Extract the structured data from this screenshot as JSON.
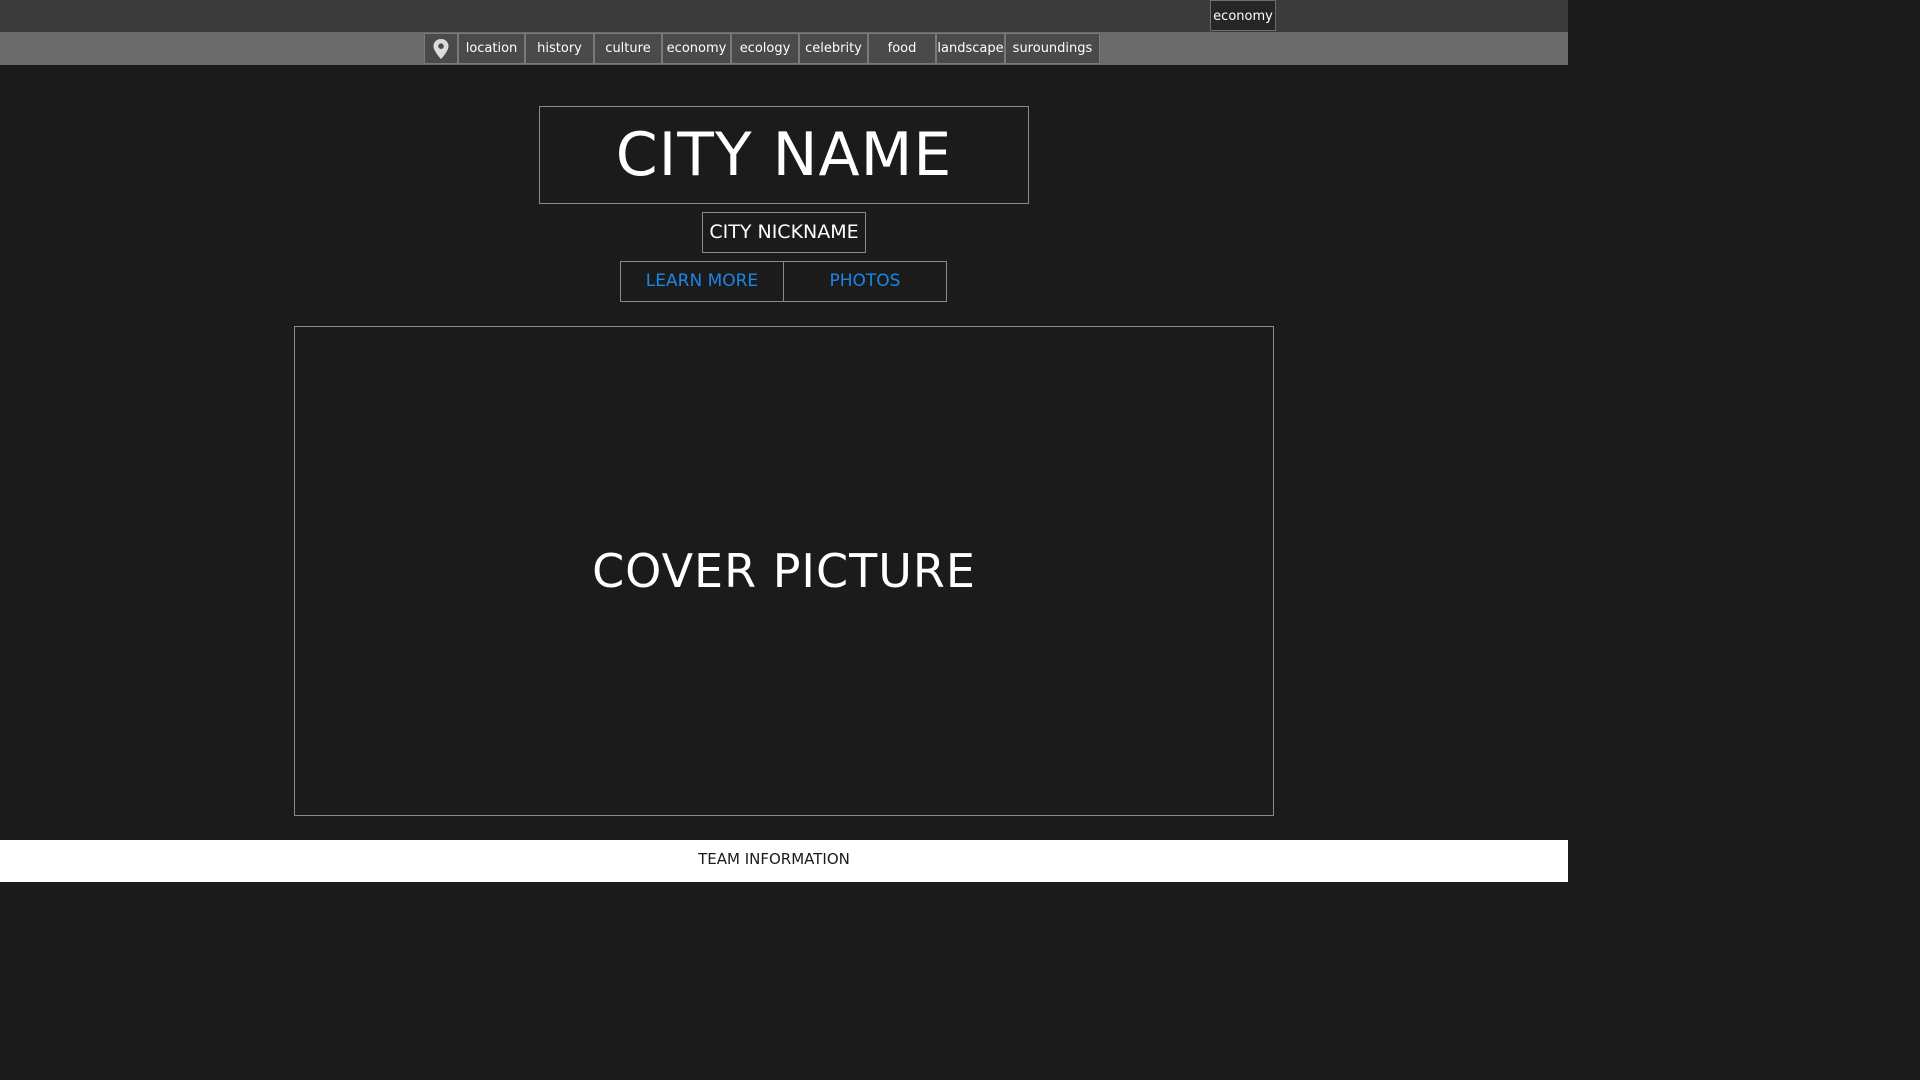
{
  "top_bar": {
    "badge": "economy"
  },
  "nav": {
    "pin_icon": "map-pin-icon",
    "items": [
      {
        "label": "location"
      },
      {
        "label": "history"
      },
      {
        "label": "culture"
      },
      {
        "label": "economy"
      },
      {
        "label": "ecology"
      },
      {
        "label": "celebrity"
      },
      {
        "label": "food"
      },
      {
        "label": "landscape"
      },
      {
        "label": "suroundings"
      }
    ]
  },
  "hero": {
    "city_name": "CITY NAME",
    "city_nickname": "CITY NICKNAME",
    "learn_more_label": "LEARN MORE",
    "photos_label": "PHOTOS"
  },
  "cover": {
    "label": "COVER PICTURE"
  },
  "footer": {
    "label": "TEAM INFORMATION"
  },
  "colors": {
    "background": "#1b1b1b",
    "top_bar": "#3b3b3b",
    "nav_bar": "#6b6b6b",
    "link_blue": "#1a86e8",
    "footer_bg": "#ffffff"
  }
}
